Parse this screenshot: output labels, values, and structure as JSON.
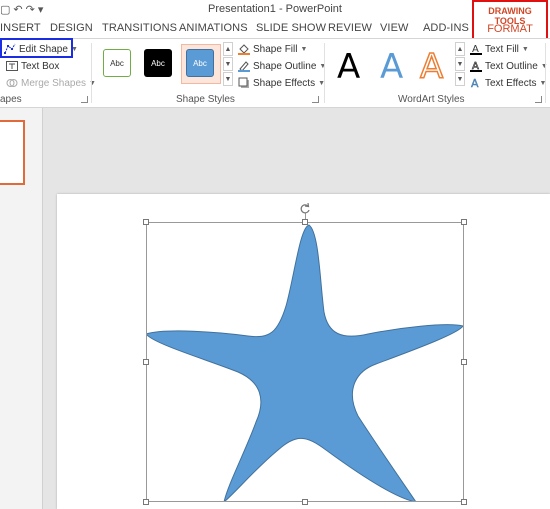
{
  "window": {
    "title": "Presentation1 - PowerPoint"
  },
  "tabs": [
    "INSERT",
    "DESIGN",
    "TRANSITIONS",
    "ANIMATIONS",
    "SLIDE SHOW",
    "REVIEW",
    "VIEW",
    "ADD-INS"
  ],
  "contextual": {
    "group_label": "DRAWING TOOLS",
    "tab_label": "FORMAT"
  },
  "insert_shapes": {
    "edit_shape": "Edit Shape",
    "text_box": "Text Box",
    "merge_shapes": "Merge Shapes",
    "group_label": "apes"
  },
  "shape_styles": {
    "swatch_text": [
      "Abc",
      "Abc",
      "Abc"
    ],
    "fill": "Shape Fill",
    "outline": "Shape Outline",
    "effects": "Shape Effects",
    "group_label": "Shape Styles"
  },
  "wordart": {
    "letters": [
      "A",
      "A",
      "A"
    ],
    "text_fill": "Text Fill",
    "text_outline": "Text Outline",
    "text_effects": "Text Effects",
    "group_label": "WordArt Styles"
  },
  "colors": {
    "accent": "#d24726",
    "shape_fill": "#5b9bd5",
    "shape_outline": "#41719c",
    "highlight_red": "#e01010",
    "highlight_blue": "#1a2de0"
  },
  "icons": {
    "qat": [
      "save-icon",
      "undo-icon",
      "redo-icon",
      "customize-icon"
    ],
    "edit_shape": "edit-points-icon",
    "text_box": "text-box-icon",
    "merge_shapes": "merge-shapes-icon",
    "shape_fill": "paint-bucket-icon",
    "shape_outline": "pen-icon",
    "shape_effects": "effects-icon",
    "text_fill": "text-fill-icon",
    "text_outline": "text-outline-icon",
    "text_effects": "text-effects-icon"
  }
}
